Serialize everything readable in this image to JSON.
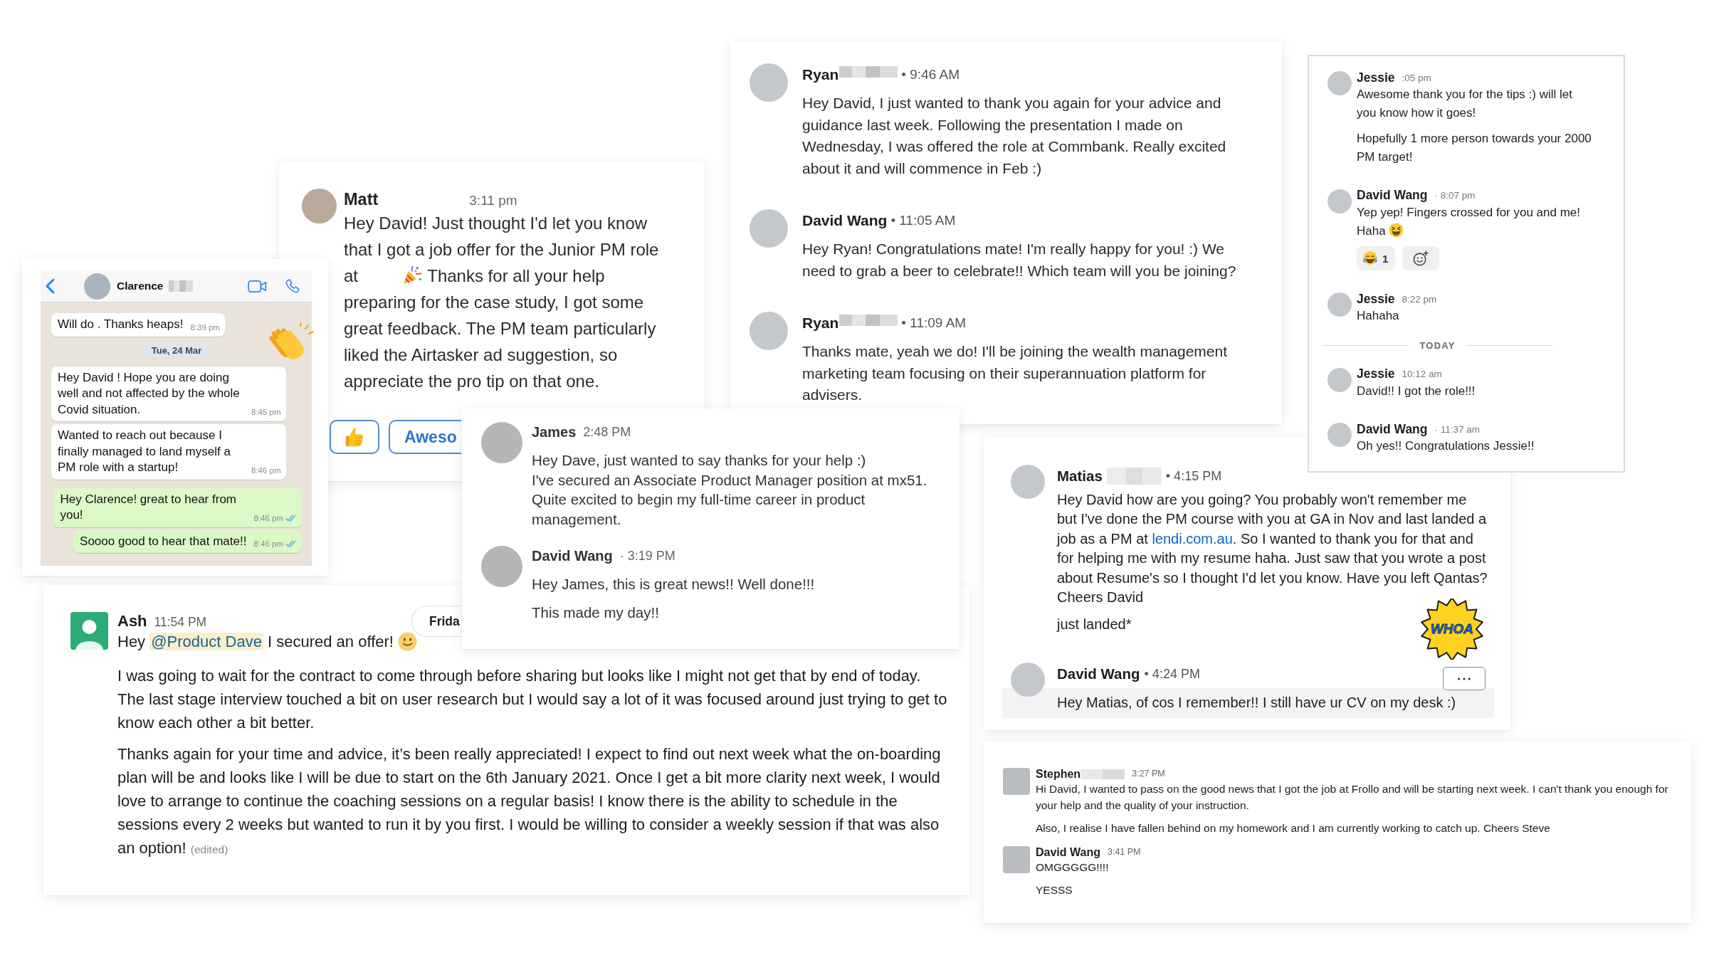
{
  "whatsapp_chat": {
    "contact": {
      "name": "Clarence",
      "redacted": true
    },
    "messages": [
      {
        "kind": "incoming",
        "text": "Will do . Thanks heaps!",
        "time": "8:39 pm"
      },
      {
        "kind": "date",
        "text": "Tue, 24 Mar"
      },
      {
        "kind": "incoming",
        "text": "Hey David ! Hope you are doing well and not affected by the whole Covid situation.",
        "time": "8:45 pm"
      },
      {
        "kind": "incoming",
        "text": "Wanted to reach out because I finally managed to land myself a PM role with a startup!",
        "time": "8:46 pm"
      },
      {
        "kind": "outgoing",
        "text": "Hey Clarence! great to hear from you!",
        "time": "8:46 pm",
        "read": true
      },
      {
        "kind": "outgoing",
        "text": "Soooo good to hear that mate!!",
        "time": "8:46 pm",
        "read": true
      }
    ]
  },
  "matt_message": {
    "sender": "Matt",
    "time": "3:11 pm",
    "text_before": "Hey David! Just thought I'd let you know that I got a job offer for the Junior PM role at",
    "text_after": "Thanks for all your help preparing for the case study, I got some great feedback. The PM team particularly liked the Airtasker ad suggestion, so appreciate the pro tip on that one.",
    "quick_replies": [
      {
        "kind": "emoji"
      },
      {
        "kind": "text",
        "label": "Aweso"
      }
    ]
  },
  "ryan_thread": {
    "messages": [
      {
        "sender": "Ryan",
        "redacted": true,
        "time": "• 9:46 AM",
        "text": "Hey David, I just wanted to thank you again for your advice and guidance last week. Following the presentation I made on Wednesday, I was offered the role at Commbank. Really excited about it and will commence in Feb :)"
      },
      {
        "sender": "David Wang",
        "time": "• 11:05 AM",
        "text": "Hey Ryan! Congratulations mate! I'm really happy for you! :) We need to grab a beer to celebrate!! Which team will you be joining?"
      },
      {
        "sender": "Ryan",
        "redacted": true,
        "time": "• 11:09 AM",
        "text": "Thanks mate, yeah we do! I'll be joining the wealth management marketing team focusing on their superannuation platform for advisers."
      }
    ]
  },
  "jessie_thread": {
    "items": [
      {
        "kind": "message",
        "sender": "Jessie",
        "time": ":05 pm",
        "paragraphs": [
          "Awesome thank you for the tips :) will let you know how it goes!",
          "Hopefully 1 more person towards your 2000 PM target!"
        ]
      },
      {
        "kind": "message",
        "sender": "David Wang",
        "time": "· 8:07 pm",
        "paragraphs": [
          "Yep yep! Fingers crossed for you and me! Haha"
        ],
        "emoji_after": true,
        "reactions": [
          {
            "count": "1"
          }
        ]
      },
      {
        "kind": "message",
        "sender": "Jessie",
        "time": "8:22 pm",
        "paragraphs": [
          "Hahaha"
        ]
      },
      {
        "kind": "divider",
        "label": "TODAY"
      },
      {
        "kind": "message",
        "sender": "Jessie",
        "time": "10:12 am",
        "paragraphs": [
          "David!! I got the role!!!"
        ]
      },
      {
        "kind": "message",
        "sender": "David Wang",
        "time": "· 11:37 am",
        "paragraphs": [
          "Oh yes!! Congratulations Jessie!!"
        ]
      }
    ]
  },
  "james_thread": {
    "messages": [
      {
        "sender": "James",
        "time": "2:48 PM",
        "paragraphs": [
          "Hey Dave, just wanted to say thanks for your help :)\nI've secured an Associate Product Manager position at mx51.\nQuite excited to begin my full-time career in product management."
        ]
      },
      {
        "sender": "David Wang",
        "time": "· 3:19 PM",
        "paragraphs": [
          "Hey James, this is great news!! Well done!!!",
          "This made my day!!"
        ]
      }
    ]
  },
  "ash_message": {
    "sender": "Ash",
    "time": "11:54 PM",
    "date_divider": "Frida",
    "greeting": {
      "before": "Hey",
      "mention": "@Product Dave",
      "after": "I secured an offer!"
    },
    "paragraphs": [
      "I was going to wait for the contract to come through before sharing but looks like I might not get that by end of today. The last stage interview touched a bit on user research but I would say a lot of it was focused around just trying to get to know each other a bit better.",
      "Thanks again for your time and advice, it’s been really appreciated! I expect to find out next week what the on-boarding plan will be and looks like I will be due to start on the 6th January 2021. Once I get a bit more clarity next week, I would love to arrange to continue the coaching sessions on a regular basis! I know there is the ability to schedule in the sessions every 2 weeks but wanted to run it by you first. I would be willing to consider a weekly session if that was also an option!"
    ],
    "edited_label": "(edited)"
  },
  "matias_thread": {
    "messages": [
      {
        "sender": "Matias",
        "redacted": true,
        "time": "• 4:15 PM",
        "text": "Hey David how are you going? You probably won't remember me but I've done the PM course with you at GA in Nov and last landed a job as a PM at",
        "link": "lendi.com.au",
        "text_end": ". So I wanted to thank you for that and for helping me with my resume haha. Just saw that you wrote a post about Resume's so I thought I'd let you know. Have you left Qantas? Cheers David",
        "note": "just landed*",
        "sticker": "WHOA"
      },
      {
        "sender": "David Wang",
        "time": "• 4:24 PM",
        "text": "Hey Matias, of cos I remember!! I still have ur CV on my desk :)",
        "hovered": true
      }
    ]
  },
  "stephen_thread": {
    "messages": [
      {
        "sender": "Stephen",
        "redacted": true,
        "time": "3:27 PM",
        "paragraphs": [
          "Hi David, I wanted to pass on the good news that I got the job at Frollo and will be starting next week. I can't thank you enough for your help and the quality of your instruction.",
          "Also, I realise I have fallen behind on my homework and I am currently working to catch up. Cheers Steve"
        ]
      },
      {
        "sender": "David Wang",
        "time": "3:41 PM",
        "paragraphs": [
          "OMGGGGG!!!!",
          "YESSS"
        ]
      }
    ]
  }
}
